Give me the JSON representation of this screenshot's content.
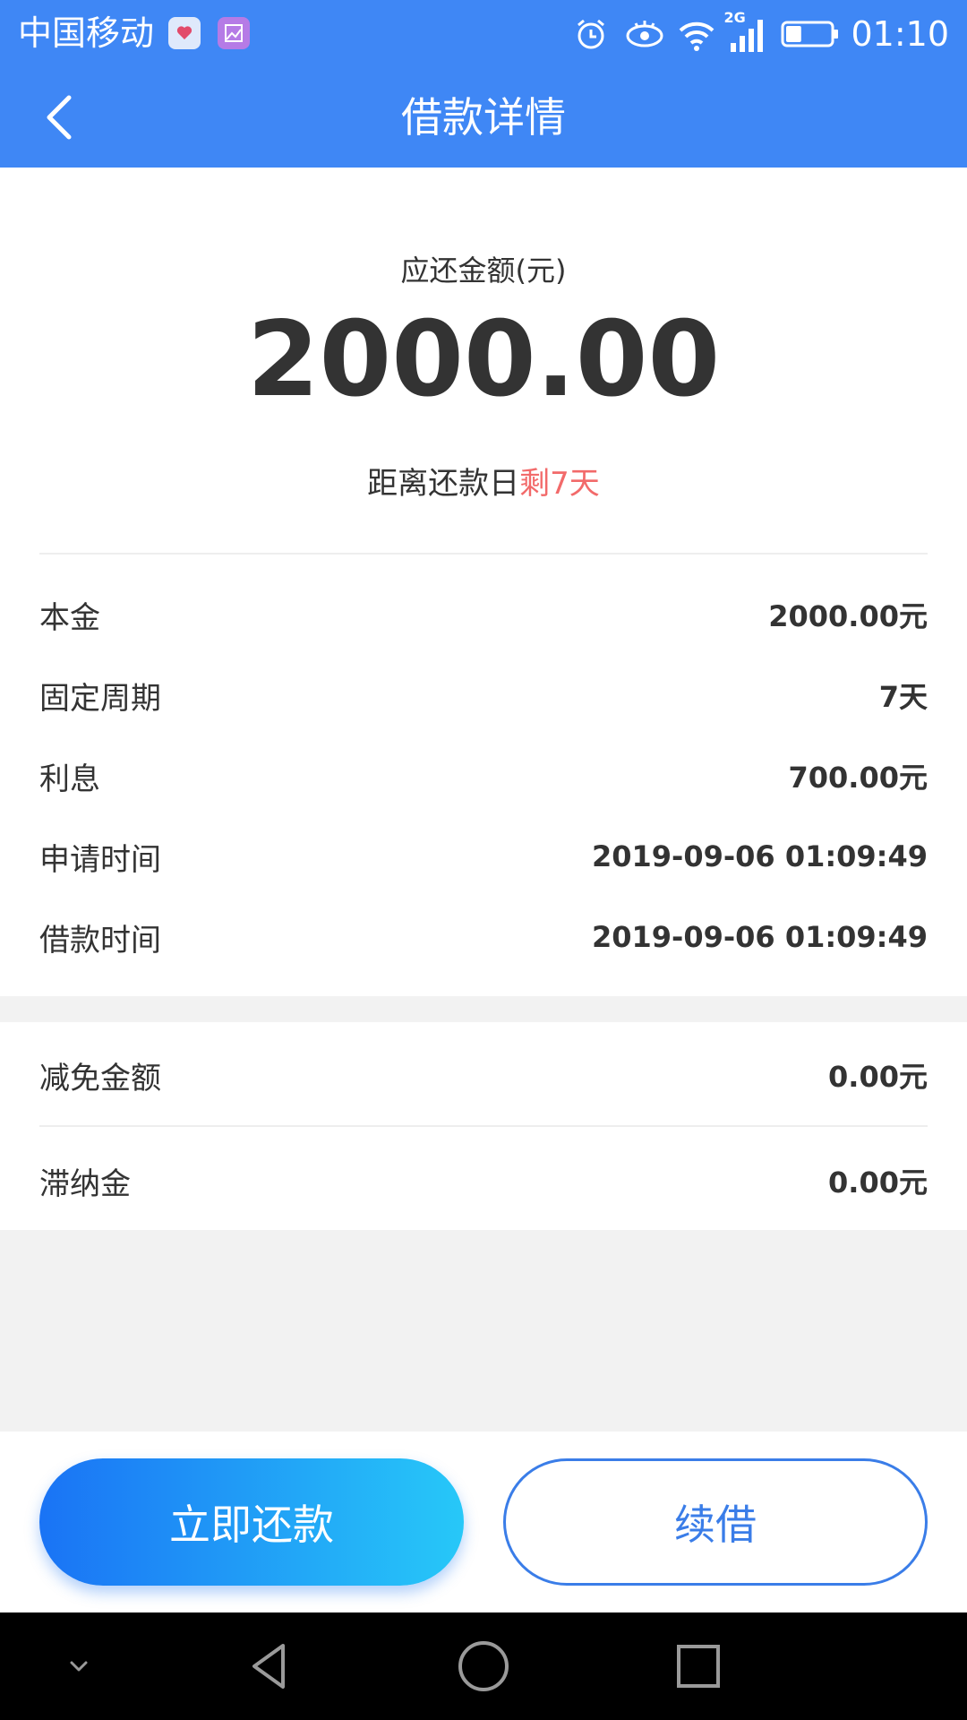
{
  "status_bar": {
    "carrier": "中国移动",
    "network": "2G",
    "time": "01:10",
    "icons": [
      "health-app-icon",
      "gallery-icon",
      "alarm-icon",
      "eye-icon",
      "wifi-icon",
      "signal-icon",
      "battery-icon"
    ],
    "battery_level": 0.35
  },
  "header": {
    "title": "借款详情",
    "back_icon": "chevron-left-icon"
  },
  "summary": {
    "amount_label": "应还金额(元)",
    "amount": "2000.00",
    "countdown_prefix": "距离还款日",
    "countdown_highlight": "剩7天"
  },
  "details": [
    {
      "label": "本金",
      "value": "2000.00元"
    },
    {
      "label": "固定周期",
      "value": "7天"
    },
    {
      "label": "利息",
      "value": "700.00元"
    },
    {
      "label": "申请时间",
      "value": "2019-09-06 01:09:49"
    },
    {
      "label": "借款时间",
      "value": "2019-09-06 01:09:49"
    }
  ],
  "fees": [
    {
      "label": "减免金额",
      "value": "0.00元"
    },
    {
      "label": "滞纳金",
      "value": "0.00元"
    }
  ],
  "actions": {
    "repay_label": "立即还款",
    "renew_label": "续借"
  },
  "nav_bar": {
    "icons": [
      "collapse-icon",
      "back-triangle-icon",
      "home-circle-icon",
      "recents-square-icon"
    ]
  },
  "colors": {
    "primary": "#3f87f5",
    "highlight": "#f26a6a",
    "gradient_start": "#1a73f5",
    "gradient_end": "#27c8f8",
    "outline_button": "#3a7de8"
  }
}
